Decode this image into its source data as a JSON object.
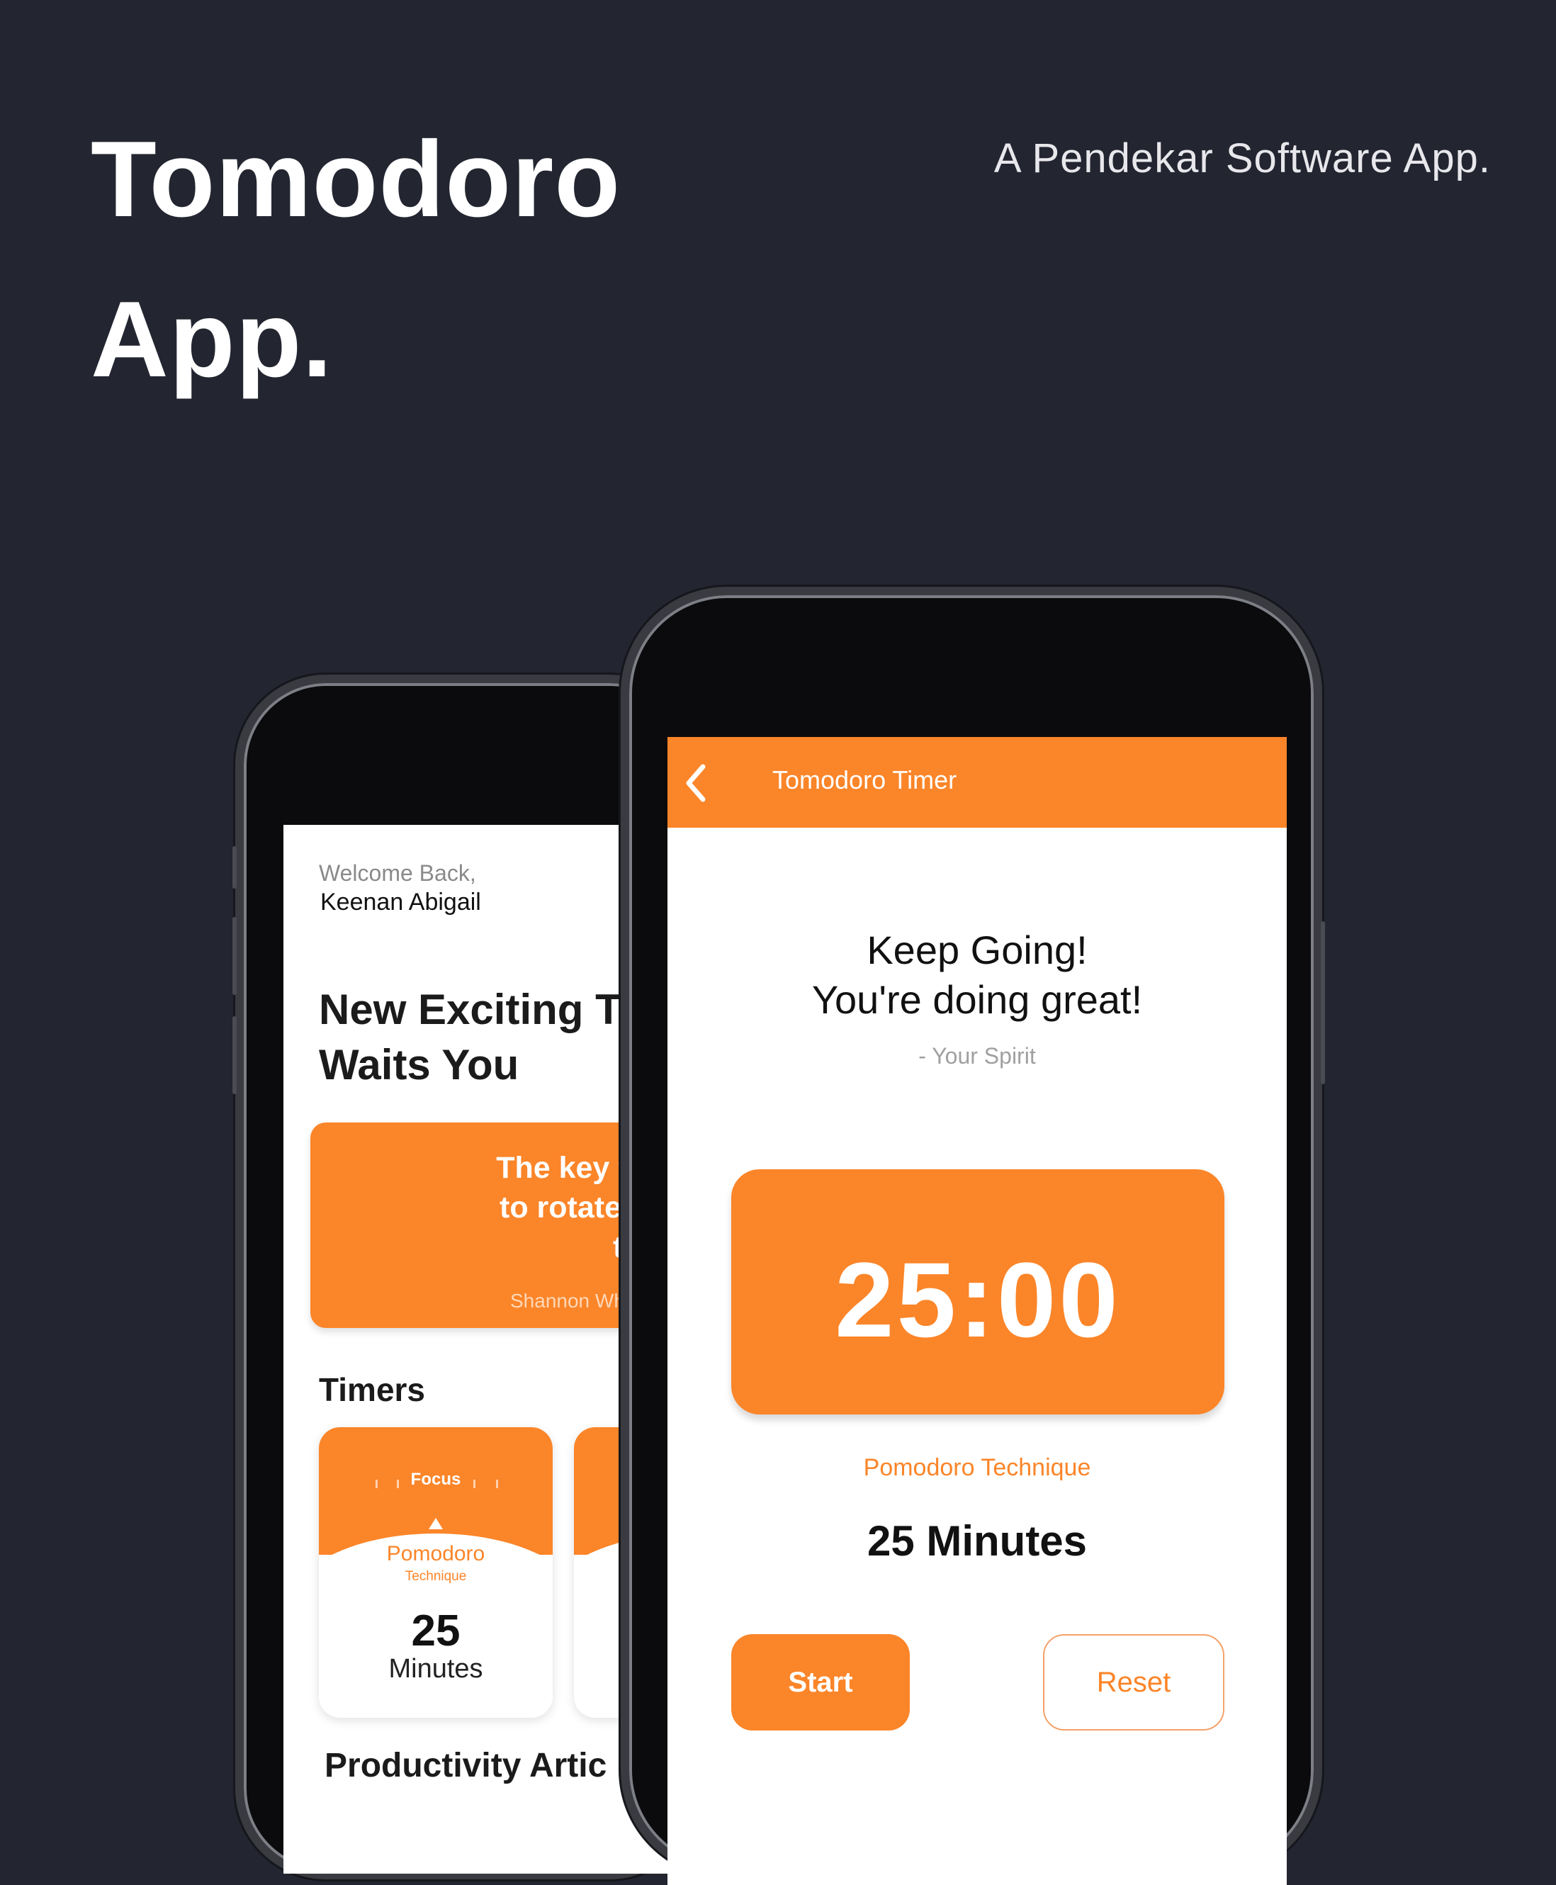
{
  "hero": {
    "title_line1": "Tomodoro",
    "title_line2": "App.",
    "subtitle": "A Pendekar Software App."
  },
  "home_screen": {
    "welcome": "Welcome Back,",
    "username": "Keenan Abigail",
    "headline_line1": "New Exciting T",
    "headline_line2": "Waits You",
    "quote": {
      "text": "The key to proc\nto rotate your a\ntechniq",
      "author": "Shannon Wh"
    },
    "timers_heading": "Timers",
    "timer_card": {
      "label": "Focus",
      "name": "Pomodoro",
      "subname": "Technique",
      "value": "25",
      "unit": "Minutes"
    },
    "articles_heading": "Productivity Artic"
  },
  "timer_screen": {
    "title": "Tomodoro Timer",
    "motto_line1": "Keep Going!",
    "motto_line2": "You're doing great!",
    "motto_author": "- Your Spirit",
    "timer_value": "25:00",
    "technique": "Pomodoro Technique",
    "duration": "25 Minutes",
    "start_label": "Start",
    "reset_label": "Reset"
  },
  "colors": {
    "background": "#232531",
    "accent": "#fb8529",
    "text_light": "#ffffff",
    "text_dark": "#111111"
  }
}
